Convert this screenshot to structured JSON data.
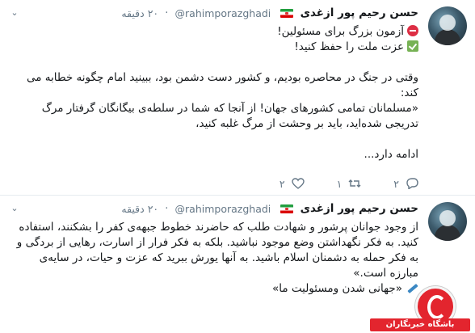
{
  "tweets": [
    {
      "name": "حسن رحیم پور ازغدی",
      "handle": "@rahimporazghadi",
      "separator": "·",
      "time": "۲۰ دقیقه",
      "lines": [
        "آزمون بزرگ برای مسئولین!",
        "عزت ملت را حفظ کنید!",
        "",
        "وقتی در جنگ در محاصره بودیم، و کشور دست دشمن بود، ببینید امام چگونه خطابه می کند:",
        "«مسلمانان تمامی کشورهای جهان! از آنجا که شما در سلطه‌ی بیگانگان گرفتار مرگ تدریجی شده‌اید، باید بر وحشت از مرگ غلبه کنید،",
        "",
        "ادامه دارد..."
      ],
      "replies": "۲",
      "retweets": "۱",
      "likes": "۲"
    },
    {
      "name": "حسن رحیم پور ازغدی",
      "handle": "@rahimporazghadi",
      "separator": "·",
      "time": "۲۰ دقیقه",
      "lines": [
        "از وجود جوانان پرشور و شهادت طلب که حاضرند خطوط جبهه‌ی کفر را بشکنند، استفاده کنید. به فکر نگهداشتن وضع موجود نباشید. بلکه به فکر فرار از اسارت، رهایی از بردگی و به فکر حمله به دشمنان اسلام باشید. به آنها یورش ببرید که عزت و حیات، در سایه‌ی مبارزه است.»",
        "«جهانی شدن ومسئولیت ما»"
      ]
    }
  ],
  "icons": {
    "chevron": "chevron-down-icon",
    "reply": "reply-icon",
    "retweet": "retweet-icon",
    "like": "heart-icon"
  },
  "watermark": {
    "label": "باشگاه خبرنگاران"
  },
  "colors": {
    "muted": "#657786",
    "border": "#e6ecf0",
    "brand_red": "#e3252e"
  }
}
